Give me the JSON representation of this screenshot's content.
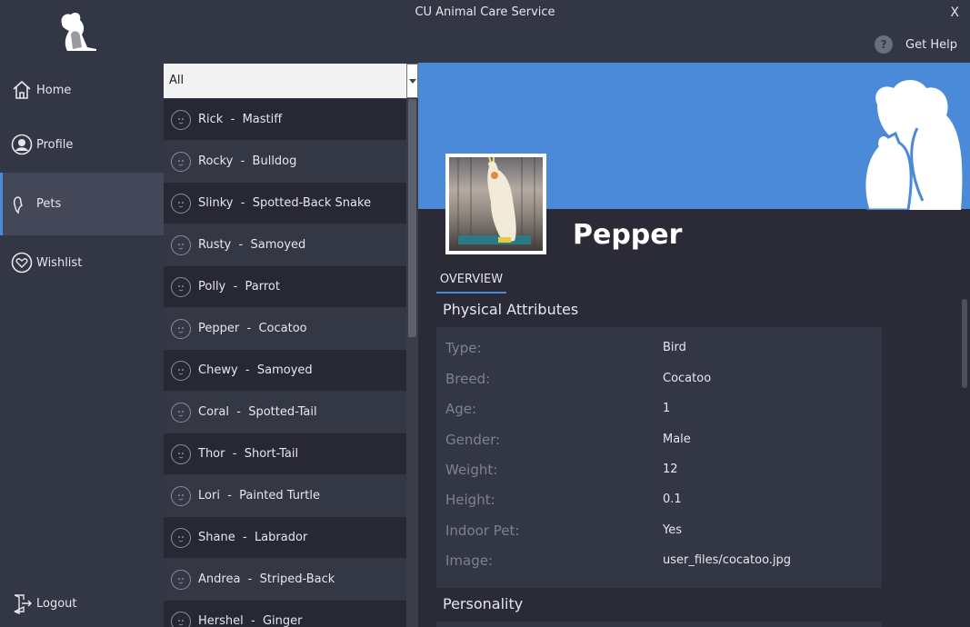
{
  "window": {
    "title": "CU Animal Care Service",
    "close_label": "X"
  },
  "help": {
    "label": "Get Help",
    "icon": "question-icon",
    "glyph": "?"
  },
  "nav": {
    "items": [
      {
        "label": "Home",
        "icon": "home-icon"
      },
      {
        "label": "Profile",
        "icon": "profile-icon"
      },
      {
        "label": "Pets",
        "icon": "pets-icon",
        "active": true
      },
      {
        "label": "Wishlist",
        "icon": "heart-icon"
      }
    ],
    "logout_label": "Logout"
  },
  "filter": {
    "selected": "All"
  },
  "pets": [
    {
      "name": "Rick",
      "breed": "Mastiff",
      "icon": "dog-icon"
    },
    {
      "name": "Rocky",
      "breed": "Bulldog",
      "icon": "dog-icon"
    },
    {
      "name": "Slinky",
      "breed": "Spotted-Back Snake",
      "icon": "snake-icon"
    },
    {
      "name": "Rusty",
      "breed": "Samoyed",
      "icon": "dog-icon"
    },
    {
      "name": "Polly",
      "breed": "Parrot",
      "icon": "bird-icon"
    },
    {
      "name": "Pepper",
      "breed": "Cocatoo",
      "icon": "bird-icon"
    },
    {
      "name": "Chewy",
      "breed": "Samoyed",
      "icon": "dog-icon"
    },
    {
      "name": "Coral",
      "breed": "Spotted-Tail",
      "icon": "cat-icon"
    },
    {
      "name": "Thor",
      "breed": "Short-Tail",
      "icon": "rabbit-icon"
    },
    {
      "name": "Lori",
      "breed": "Painted Turtle",
      "icon": "snake-icon"
    },
    {
      "name": "Shane",
      "breed": "Labrador",
      "icon": "dog-icon"
    },
    {
      "name": "Andrea",
      "breed": "Striped-Back",
      "icon": "cat-icon"
    },
    {
      "name": "Hershel",
      "breed": "Ginger",
      "icon": "cat-icon"
    }
  ],
  "detail": {
    "name": "Pepper",
    "tab": "OVERVIEW",
    "section_physical": "Physical Attributes",
    "section_personality": "Personality",
    "attributes": [
      {
        "key": "Type:",
        "value": "Bird"
      },
      {
        "key": "Breed:",
        "value": "Cocatoo"
      },
      {
        "key": "Age:",
        "value": "1"
      },
      {
        "key": "Gender:",
        "value": "Male"
      },
      {
        "key": "Weight:",
        "value": "12"
      },
      {
        "key": "Height:",
        "value": "0.1"
      },
      {
        "key": "Indoor Pet:",
        "value": "Yes"
      },
      {
        "key": "Image:",
        "value": "user_files/cocatoo.jpg"
      }
    ]
  },
  "colors": {
    "accent": "#4a8ad8",
    "background": "#333644",
    "panel": "#2a2b36"
  }
}
